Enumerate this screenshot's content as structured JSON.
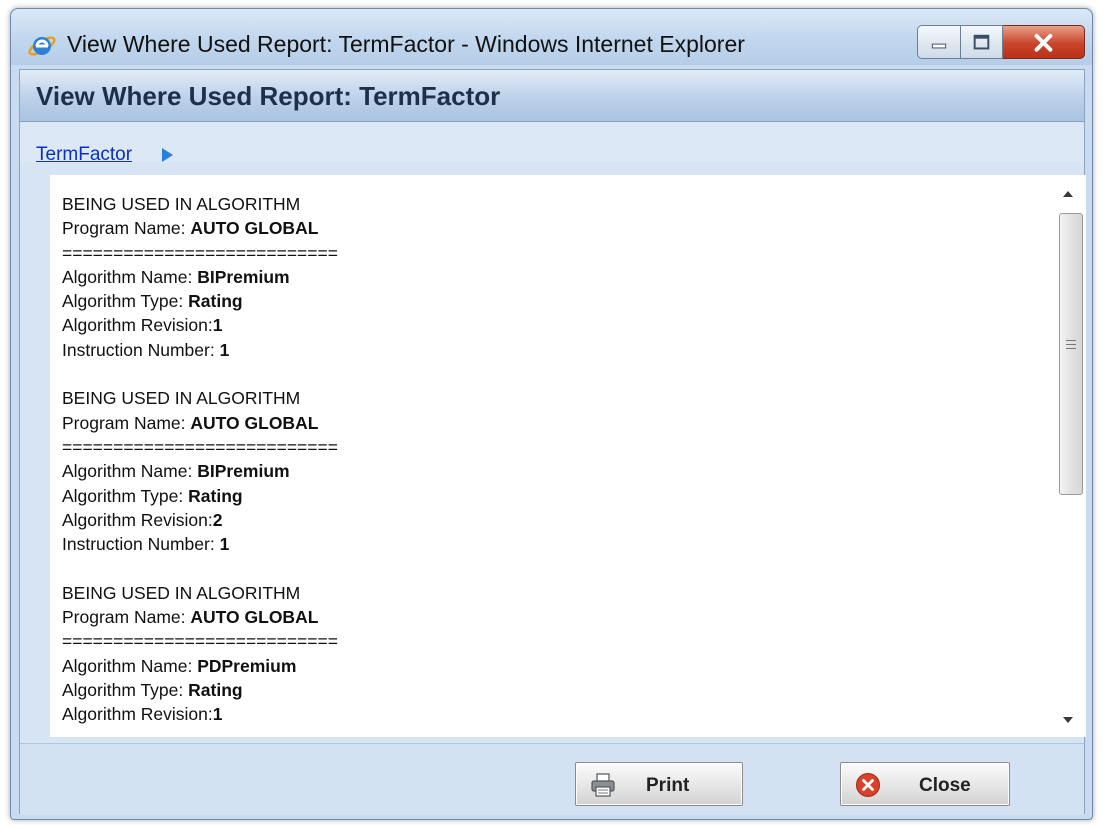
{
  "window": {
    "title": "View Where Used Report: TermFactor - Windows Internet Explorer",
    "controls": {
      "minimize": "minimize",
      "maximize": "maximize",
      "close": "close"
    }
  },
  "header": {
    "title": "View Where Used Report: TermFactor"
  },
  "breadcrumb": {
    "link": "TermFactor"
  },
  "report": {
    "entries": [
      {
        "heading": "BEING USED IN ALGORITHM",
        "program_label": "Program Name:",
        "program_value": "AUTO GLOBAL",
        "separator": "===========================",
        "name_label": "Algorithm Name:",
        "name_value": "BIPremium",
        "type_label": "Algorithm Type:",
        "type_value": "Rating",
        "revision_label": "Algorithm Revision:",
        "revision_value": "1",
        "instruction_label": "Instruction Number:",
        "instruction_value": "1"
      },
      {
        "heading": "BEING USED IN ALGORITHM",
        "program_label": "Program Name:",
        "program_value": "AUTO GLOBAL",
        "separator": "===========================",
        "name_label": "Algorithm Name:",
        "name_value": "BIPremium",
        "type_label": "Algorithm Type:",
        "type_value": "Rating",
        "revision_label": "Algorithm Revision:",
        "revision_value": "2",
        "instruction_label": "Instruction Number:",
        "instruction_value": "1"
      },
      {
        "heading": "BEING USED IN ALGORITHM",
        "program_label": "Program Name:",
        "program_value": "AUTO GLOBAL",
        "separator": "===========================",
        "name_label": "Algorithm Name:",
        "name_value": "PDPremium",
        "type_label": "Algorithm Type:",
        "type_value": "Rating",
        "revision_label": "Algorithm Revision:",
        "revision_value": "1"
      }
    ]
  },
  "footer": {
    "print_label": "Print",
    "close_label": "Close"
  },
  "icons": {
    "browser": "internet-explorer-icon",
    "breadcrumb": "triangle-right-icon",
    "print": "printer-icon",
    "close": "red-x-circle-icon"
  },
  "colors": {
    "link": "#0a2fc4",
    "header_text": "#1e2f4a",
    "close_accent": "#d9412a"
  }
}
